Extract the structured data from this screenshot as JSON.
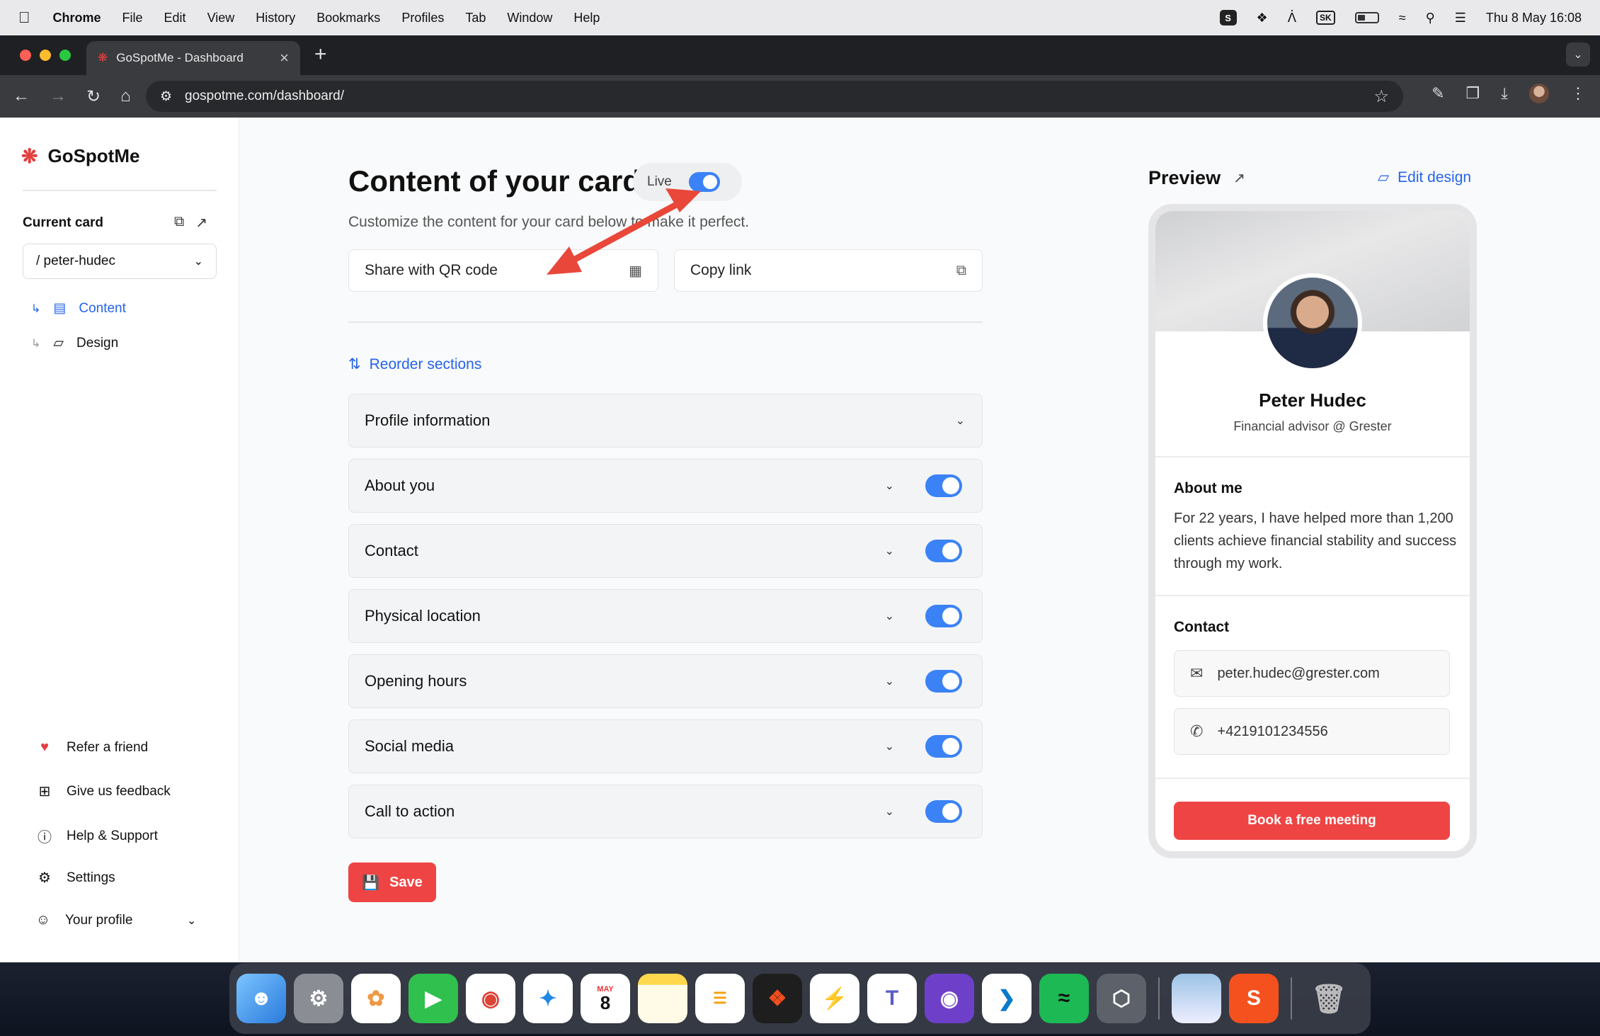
{
  "menubar": {
    "app": "Chrome",
    "items": [
      "File",
      "Edit",
      "View",
      "History",
      "Bookmarks",
      "Profiles",
      "Tab",
      "Window",
      "Help"
    ],
    "datetime": "Thu 8 May  16:08",
    "input_source": "SK"
  },
  "browser": {
    "tab_title": "GoSpotMe - Dashboard",
    "url": "gospotme.com/dashboard/"
  },
  "sidebar": {
    "brand": "GoSpotMe",
    "current_card_label": "Current card",
    "card_value": "/ peter-hudec",
    "nav": [
      {
        "label": "Content"
      },
      {
        "label": "Design"
      }
    ],
    "footer": [
      {
        "label": "Refer a friend"
      },
      {
        "label": "Give us feedback"
      },
      {
        "label": "Help & Support"
      },
      {
        "label": "Settings"
      },
      {
        "label": "Your profile"
      }
    ]
  },
  "main": {
    "title": "Content of your card",
    "live_label": "Live",
    "subtitle": "Customize the content for your card below to make it perfect.",
    "share_label": "Share with QR code",
    "copy_label": "Copy link",
    "reorder_label": "Reorder sections",
    "sections": [
      {
        "label": "Profile information"
      },
      {
        "label": "About you"
      },
      {
        "label": "Contact"
      },
      {
        "label": "Physical location"
      },
      {
        "label": "Opening hours"
      },
      {
        "label": "Social media"
      },
      {
        "label": "Call to action"
      }
    ],
    "save_label": "Save"
  },
  "preview": {
    "title": "Preview",
    "edit_label": "Edit design",
    "name": "Peter Hudec",
    "role": "Financial advisor @ Grester",
    "about_heading": "About me",
    "about_text": "For 22 years, I have helped more than 1,200 clients achieve financial stability and success through my work.",
    "contact_heading": "Contact",
    "email": "peter.hudec@grester.com",
    "phone": "+4219101234556",
    "cta": "Book a free meeting"
  },
  "dock": {
    "calendar_month": "MAY",
    "calendar_day": "8"
  },
  "colors": {
    "accent": "#2563eb",
    "brand_red": "#ef4444",
    "toggle_on": "#3b82f6",
    "annotation_arrow": "#e8473a"
  }
}
